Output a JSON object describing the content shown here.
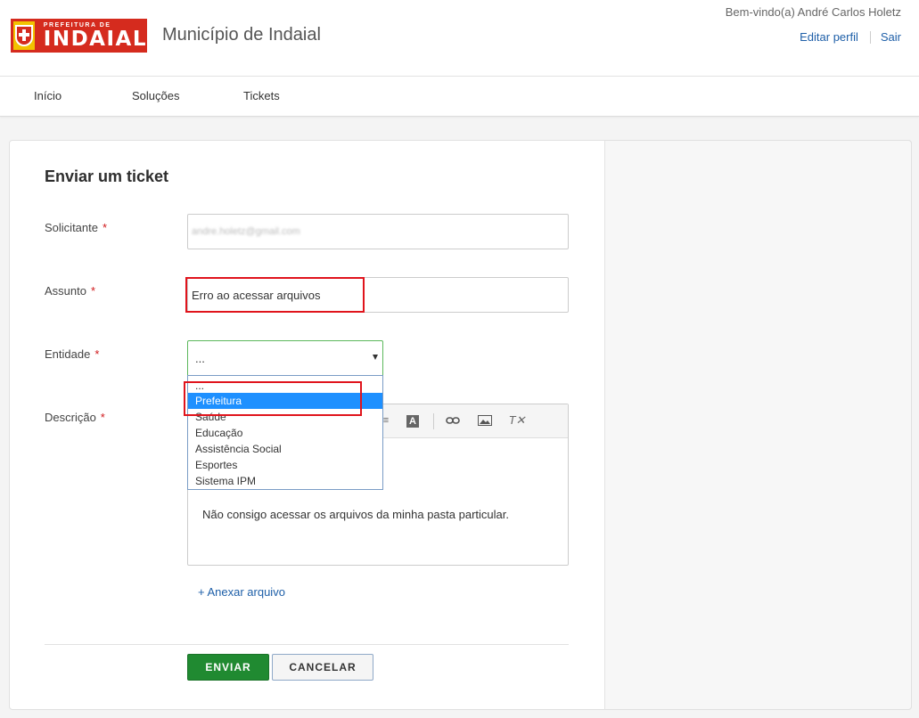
{
  "header": {
    "logo_small": "PREFEITURA DE",
    "logo_big": "INDAIAL",
    "site_name": "Município de Indaial",
    "welcome": "Bem-vindo(a) André Carlos Holetz",
    "edit_profile": "Editar perfil",
    "logout": "Sair"
  },
  "nav": {
    "items": [
      "Início",
      "Soluções",
      "Tickets"
    ]
  },
  "form": {
    "title": "Enviar um ticket",
    "requester_label": "Solicitante",
    "requester_value": "andre.holetz@gmail.com",
    "subject_label": "Assunto",
    "subject_value": "Erro ao acessar arquivos",
    "entity_label": "Entidade",
    "entity_value": "...",
    "description_label": "Descrição",
    "description_value": "Não consigo acessar os arquivos da minha pasta particular.",
    "required_mark": "*",
    "attach": "+ Anexar arquivo",
    "send": "ENVIAR",
    "cancel": "CANCELAR"
  },
  "entity_options": {
    "items": [
      "...",
      "Prefeitura",
      "Saúde",
      "Educação",
      "Assistência Social",
      "Esportes",
      "Sistema IPM"
    ],
    "selected": "Prefeitura"
  },
  "colors": {
    "brand_red": "#d52b1e",
    "brand_yellow": "#f2c200",
    "link": "#1e5fa8",
    "send_green": "#208a31",
    "highlight": "#e0141c"
  }
}
